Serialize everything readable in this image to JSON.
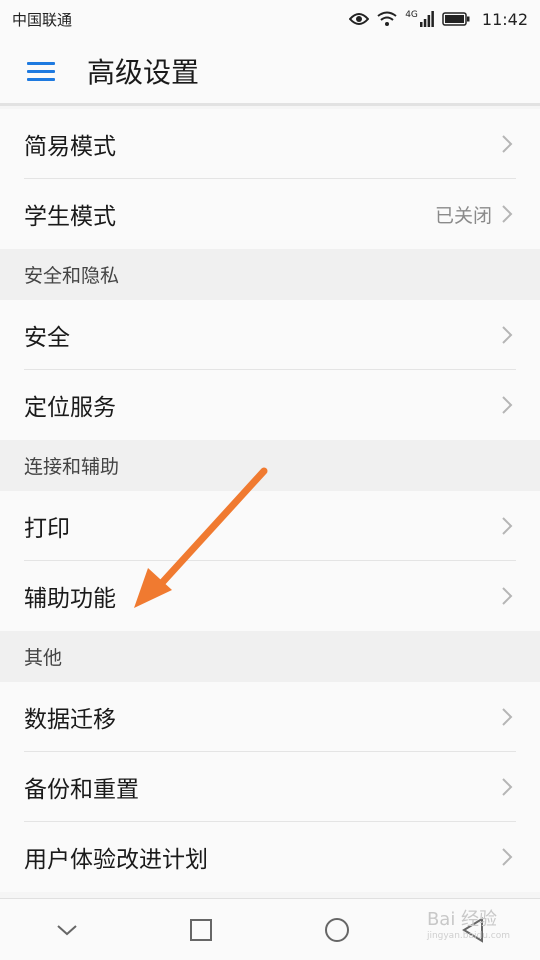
{
  "status_bar": {
    "carrier": "中国联通",
    "network": "4G",
    "time": "11:42"
  },
  "app_bar": {
    "title": "高级设置"
  },
  "rows_top": [
    {
      "label": "简易模式",
      "value": ""
    },
    {
      "label": "学生模式",
      "value": "已关闭"
    }
  ],
  "sections": [
    {
      "header": "安全和隐私",
      "items": [
        {
          "label": "安全"
        },
        {
          "label": "定位服务"
        }
      ]
    },
    {
      "header": "连接和辅助",
      "items": [
        {
          "label": "打印"
        },
        {
          "label": "辅助功能"
        }
      ]
    },
    {
      "header": "其他",
      "items": [
        {
          "label": "数据迁移"
        },
        {
          "label": "备份和重置"
        },
        {
          "label": "用户体验改进计划"
        }
      ]
    }
  ],
  "watermark": {
    "text": "Bai 经验",
    "sub": "jingyan.baidu.com"
  },
  "colors": {
    "accent": "#1e7ae0",
    "arrow": "#f07a30"
  }
}
